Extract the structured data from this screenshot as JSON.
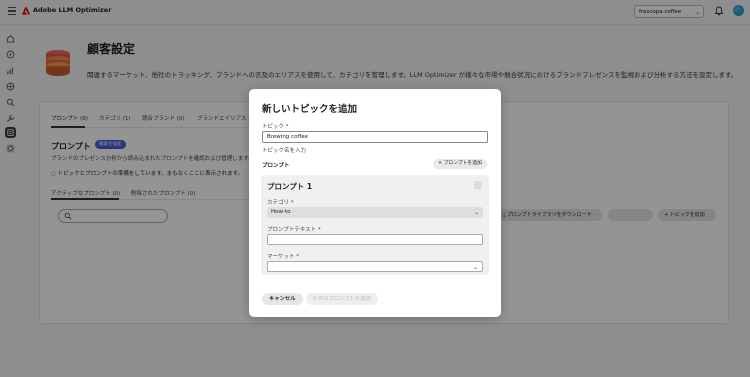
{
  "app": {
    "title": "Adobe LLM Optimizer",
    "site_selector": "frescopa.coffee"
  },
  "page": {
    "title": "顧客設定",
    "description": "関連するマーケット、他社のトラッキング、ブランドへの言及のエリアスを使用して、カテゴリを管理します。LLM Optimizer が様々な市場や競合状況におけるブランドプレゼンスを監視および分析する方法を設定します。"
  },
  "tabs": [
    "プロンプト (0)",
    "カテゴリ (1)",
    "競合ブランド (0)",
    "ブランドエイリアス (0)"
  ],
  "prompts_section": {
    "title": "プロンプト",
    "badge": "検索を強化",
    "description": "ブランドのプレゼンス分析から読み込まれたプロンプトを確認および管理します。",
    "notice": "トピックとプロンプトの準備をしています。まもなくここに表示されます。",
    "subtabs": [
      "アクティブなプロンプト (0)",
      "削除されたプロンプト (0)"
    ],
    "buttons": {
      "download": "プロンプトライブラリをダウンロード",
      "disabled": "",
      "add_topic": "トピックを追加"
    }
  },
  "modal": {
    "title": "新しいトピックを追加",
    "topic_label": "トピック *",
    "topic_value": "Brewing coffee",
    "topic_helper": "トピック名を入力",
    "prompts_label": "プロンプト",
    "add_prompt_button": "プロンプトを追加",
    "prompt_card": {
      "title": "プロンプト 1",
      "category_label": "カテゴリ *",
      "category_value": "How-to",
      "prompt_text_label": "プロンプトテキスト *",
      "market_label": "マーケット *"
    },
    "cancel_button": "キャンセル",
    "add_n_button": "0 件のプロンプトを追加"
  },
  "icons": {
    "rail": [
      "home-icon",
      "compass-icon",
      "chart-icon",
      "globe-icon",
      "search-icon",
      "wrench-icon",
      "customer-icon",
      "gear-icon"
    ]
  },
  "colors": {
    "accent": "#4b5fd6",
    "adobe_red": "#eb1000",
    "overlay": "rgba(0,0,0,0.42)"
  }
}
